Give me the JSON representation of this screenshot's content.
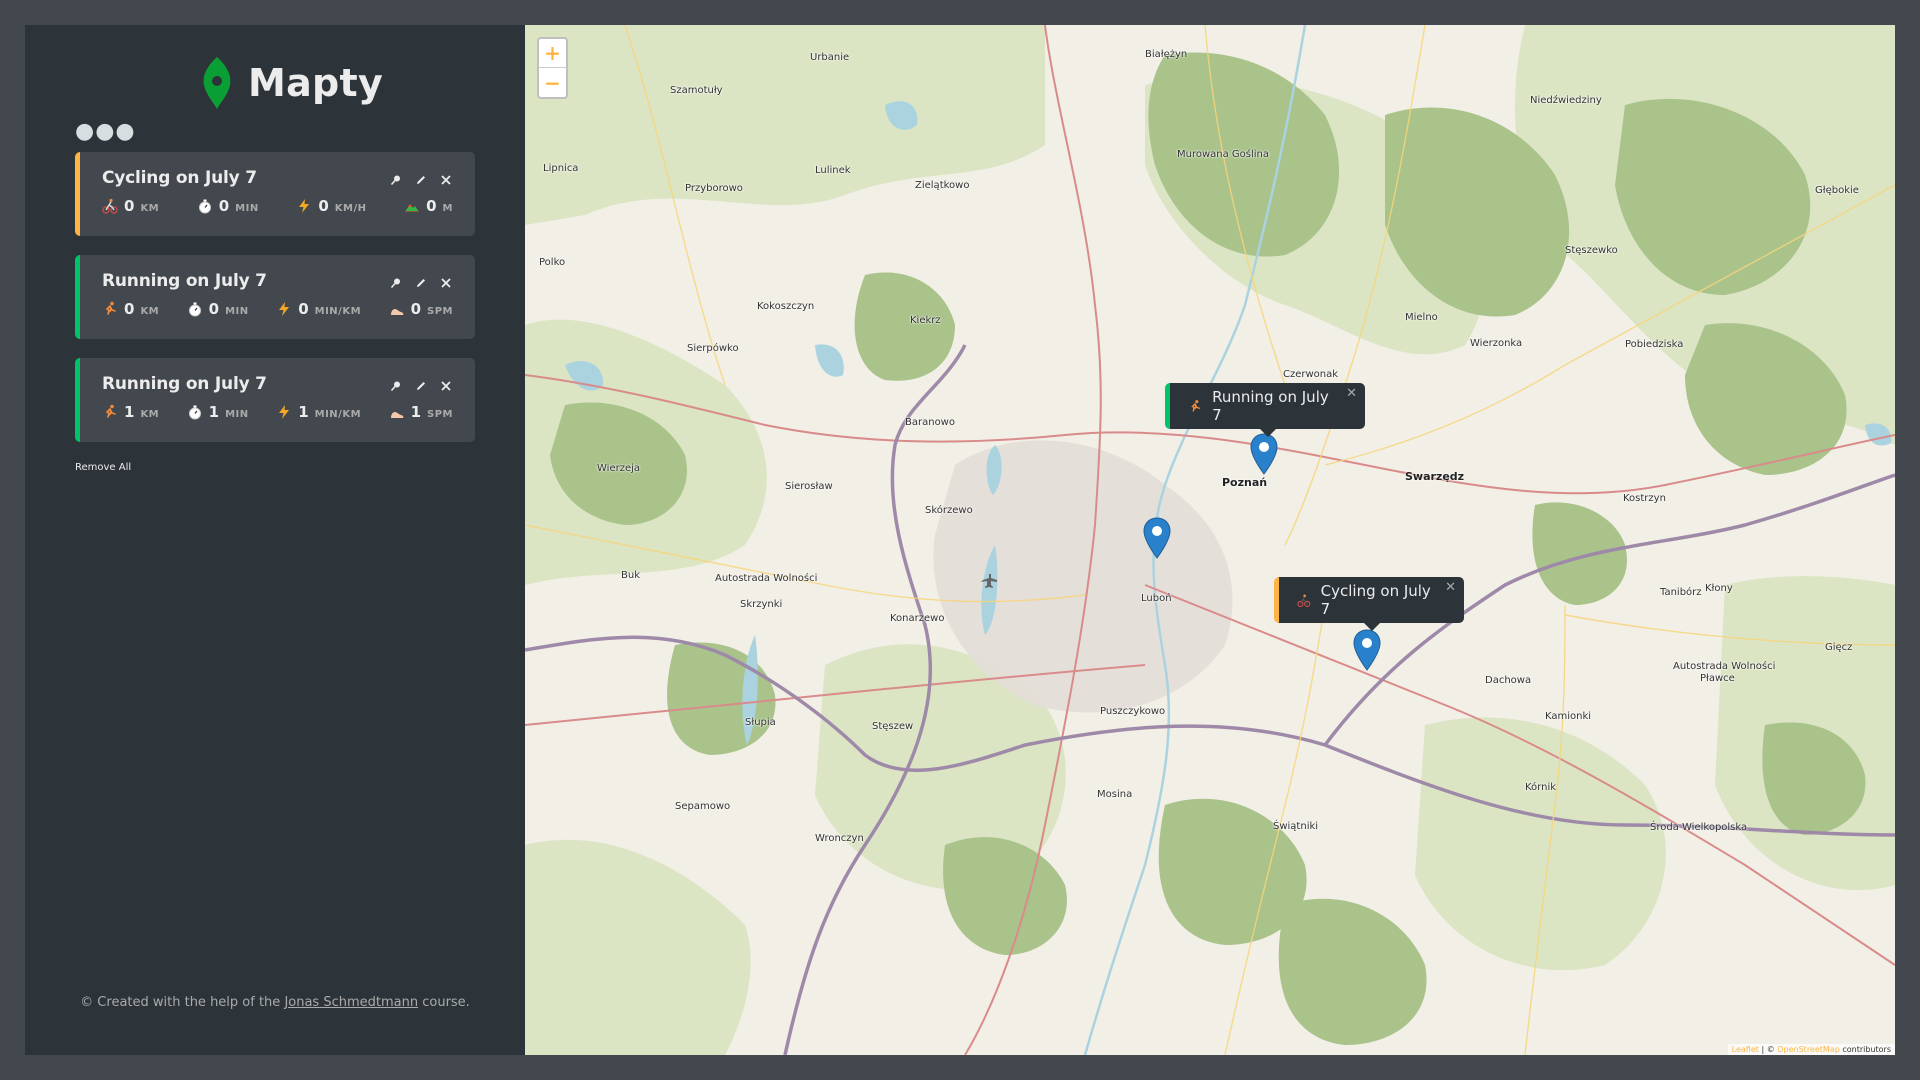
{
  "app": {
    "name": "Mapty"
  },
  "sidebar": {
    "menu_dots": "●●●",
    "remove_all": "Remove All",
    "footer": {
      "prefix": "© Created with the help of the ",
      "link": "Jonas Schmedtmann",
      "suffix": " course."
    }
  },
  "workouts": [
    {
      "type": "cycling",
      "title": "Cycling on July 7",
      "stats": [
        {
          "icon": "cyclist-icon",
          "value": "0",
          "unit": "KM"
        },
        {
          "icon": "stopwatch-icon",
          "value": "0",
          "unit": "MIN"
        },
        {
          "icon": "lightning-icon",
          "value": "0",
          "unit": "KM/H"
        },
        {
          "icon": "mountain-icon",
          "value": "0",
          "unit": "M"
        }
      ]
    },
    {
      "type": "running",
      "title": "Running on July 7",
      "stats": [
        {
          "icon": "runner-icon",
          "value": "0",
          "unit": "KM"
        },
        {
          "icon": "stopwatch-icon",
          "value": "0",
          "unit": "MIN"
        },
        {
          "icon": "lightning-icon",
          "value": "0",
          "unit": "MIN/KM"
        },
        {
          "icon": "footprint-icon",
          "value": "0",
          "unit": "SPM"
        }
      ]
    },
    {
      "type": "running",
      "title": "Running on July 7",
      "stats": [
        {
          "icon": "runner-icon",
          "value": "1",
          "unit": "KM"
        },
        {
          "icon": "stopwatch-icon",
          "value": "1",
          "unit": "MIN"
        },
        {
          "icon": "lightning-icon",
          "value": "1",
          "unit": "MIN/KM"
        },
        {
          "icon": "footprint-icon",
          "value": "1",
          "unit": "SPM"
        }
      ]
    }
  ],
  "map": {
    "zoom_in": "+",
    "zoom_out": "−",
    "popups": [
      {
        "type": "running",
        "text": "Running on July 7"
      },
      {
        "type": "cycling",
        "text": "Cycling on July 7"
      }
    ],
    "places": [
      "Urbanie",
      "Białężyn",
      "Szamotuły",
      "Lipnica",
      "Lulinek",
      "Przyborowo",
      "Zielątkowo",
      "Murowana Goślina",
      "Niedźwiedziny",
      "Głębokie",
      "Stęszewko",
      "Polko",
      "Kokoszczyn",
      "Kiekrz",
      "Mielno",
      "Wierzonka",
      "Pobiedziska",
      "Sierpówko",
      "Czerwonak",
      "Baranowo",
      "Wierzeja",
      "Sierosław",
      "Poznań",
      "Swarzędz",
      "Kostrzyn",
      "Skórzewo",
      "Autostrada Wolności",
      "Buk",
      "Skrzynki",
      "Konarzewo",
      "Luboń",
      "Tanibórz",
      "Kłony",
      "Gięcz",
      "Dachowa",
      "Autostrada Wolności",
      "Pławce",
      "Słupia",
      "Stęszew",
      "Puszczykowo",
      "Kamionki",
      "Mosina",
      "Kórnik",
      "Sepamowo",
      "Wronczyn",
      "Świątniki",
      "Środa Wielkopolska"
    ],
    "attribution": {
      "leaflet": "Leaflet",
      "sep": " | © ",
      "osm": "OpenStreetMap",
      "suffix": " contributors"
    }
  },
  "colors": {
    "running": "#00c46a",
    "cycling": "#ffb545",
    "sidebar": "#2d3439",
    "card": "#42484d",
    "marker": "#2a81cb"
  }
}
